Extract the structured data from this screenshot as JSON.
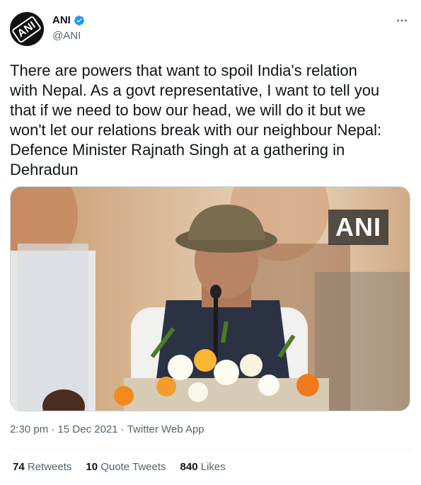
{
  "author": {
    "display_name": "ANI",
    "handle": "@ANI",
    "avatar_text": "ANI",
    "verified": true
  },
  "tweet": {
    "text": "There are powers that want to spoil India's relation\nwith Nepal. As a govt representative, I want to tell you\nthat if we need to bow our head, we will do it but we\nwon't let our relations break with our neighbour Nepal:\nDefence Minister Rajnath Singh at a gathering in\nDehradun",
    "media_watermark": "ANI"
  },
  "meta": {
    "time": "2:30 pm",
    "separator": "·",
    "date": "15 Dec 2021",
    "source": "Twitter Web App"
  },
  "stats": {
    "retweets_count": "74",
    "retweets_label": "Retweets",
    "quotes_count": "10",
    "quotes_label": "Quote Tweets",
    "likes_count": "840",
    "likes_label": "Likes"
  },
  "colors": {
    "text_primary": "#0f1419",
    "text_secondary": "#536471",
    "verified_blue": "#1d9bf0",
    "divider": "#eff3f4"
  },
  "icons": [
    "verified-badge-icon",
    "more-options-icon"
  ]
}
